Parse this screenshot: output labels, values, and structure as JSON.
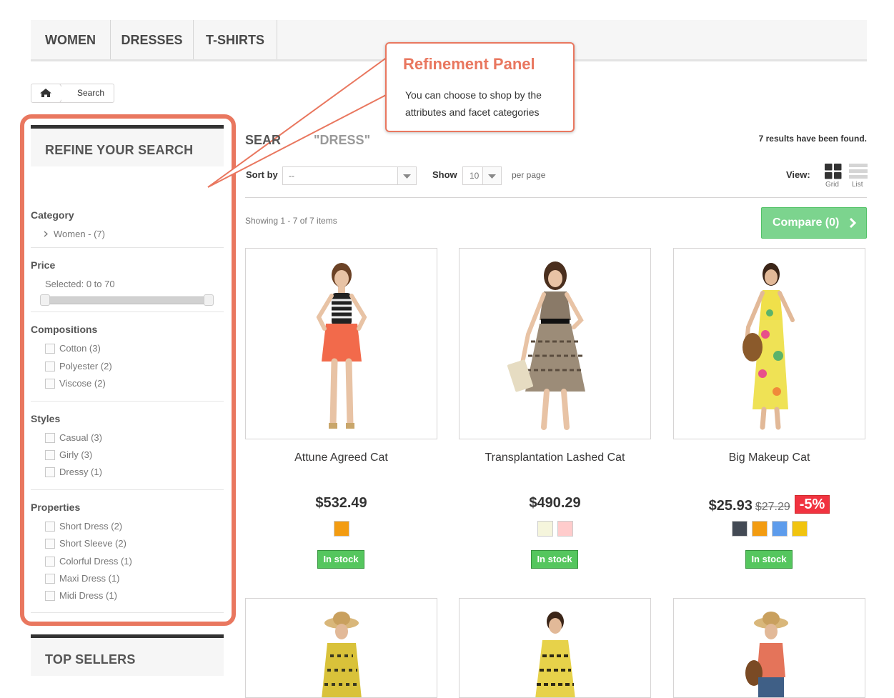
{
  "nav": {
    "items": [
      {
        "label": "WOMEN"
      },
      {
        "label": "DRESSES"
      },
      {
        "label": "T-SHIRTS"
      }
    ]
  },
  "breadcrumb": {
    "home_icon": "home-icon",
    "current": "Search"
  },
  "callout": {
    "title": "Refinement Panel",
    "text": "You can choose to shop by the attributes and facet categories"
  },
  "refine": {
    "title": "REFINE YOUR SEARCH",
    "category": {
      "title": "Category",
      "items": [
        "Women - (7)"
      ]
    },
    "price": {
      "title": "Price",
      "selected": "Selected: 0 to 70",
      "min": 0,
      "max": 70
    },
    "compositions": {
      "title": "Compositions",
      "items": [
        "Cotton (3)",
        "Polyester (2)",
        "Viscose (2)"
      ]
    },
    "styles": {
      "title": "Styles",
      "items": [
        "Casual (3)",
        "Girly (3)",
        "Dressy (1)"
      ]
    },
    "properties": {
      "title": "Properties",
      "items": [
        "Short Dress (2)",
        "Short Sleeve (2)",
        "Colorful Dress (1)",
        "Maxi Dress (1)",
        "Midi Dress (1)"
      ]
    }
  },
  "top_sellers": {
    "title": "TOP SELLERS"
  },
  "search": {
    "heading_prefix": "SEAR",
    "heading_query": "\"DRESS\"",
    "results_found": "7 results have been found."
  },
  "toolbar": {
    "sort_label": "Sort by",
    "sort_value": "--",
    "show_label": "Show",
    "show_value": "10",
    "per_page": "per page",
    "view_label": "View:",
    "grid_label": "Grid",
    "list_label": "List"
  },
  "showing": "Showing 1 - 7 of 7 items",
  "compare": {
    "label": "Compare (0)"
  },
  "products": [
    {
      "name": "Attune Agreed Cat",
      "price": "$532.49",
      "old_price": "",
      "discount": "",
      "swatches": [
        "#f39c11"
      ],
      "stock": "In stock"
    },
    {
      "name": "Transplantation Lashed Cat",
      "price": "$490.29",
      "old_price": "",
      "discount": "",
      "swatches": [
        "#f5f5dc",
        "#fcc"
      ],
      "stock": "In stock"
    },
    {
      "name": "Big Makeup Cat",
      "price": "$25.93",
      "old_price": "$27.29",
      "discount": "-5%",
      "swatches": [
        "#434a54",
        "#f39c11",
        "#5d9cec",
        "#f1c40f"
      ],
      "stock": "In stock"
    }
  ],
  "colors": {
    "accent": "#e9775f",
    "stock_green": "#55c65e",
    "compare_green": "#7cd48e",
    "discount_red": "#f13340"
  }
}
